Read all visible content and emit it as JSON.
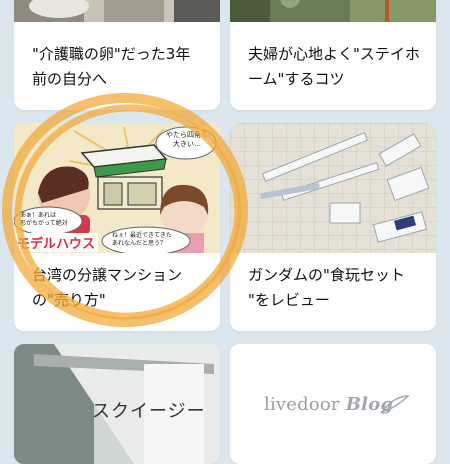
{
  "cards": [
    {
      "title_lines": [
        "\"介護職の卵\"だった3年",
        "前の自分へ"
      ],
      "image": "photo-thumbnail"
    },
    {
      "title_lines": [
        "夫婦が心地よく\"ステイホ",
        "ーム\"するコツ"
      ],
      "image": "plant-photo-thumbnail"
    },
    {
      "title_lines": [
        "台湾の分譲マンション",
        "の\"売り方\""
      ],
      "image": "comic-illustration",
      "comic": {
        "bubble_top": [
          "やたら四角く",
          "大きい…"
        ],
        "bubble_left": [
          "あぁ！あれは",
          "形がちがって絶対"
        ],
        "bubble_right": [
          "ねぇ！最近できてきた",
          "あれなんだと思う？"
        ],
        "banner": "モデルハウス"
      }
    },
    {
      "title_lines": [
        "ガンダムの\"食玩セット",
        "\"をレビュー"
      ],
      "image": "gundam-model-photo"
    },
    {
      "title_lines": [],
      "image": "squeegee-photo",
      "image_caption": "スクイージー"
    },
    {
      "title_lines": [],
      "image": "livedoor-blog-logo",
      "logo": {
        "text": "livedoor",
        "blog": "Blog"
      }
    }
  ],
  "colors": {
    "background": "#dbe6ef",
    "card": "#ffffff",
    "highlight_circle": "#f2a93b"
  }
}
